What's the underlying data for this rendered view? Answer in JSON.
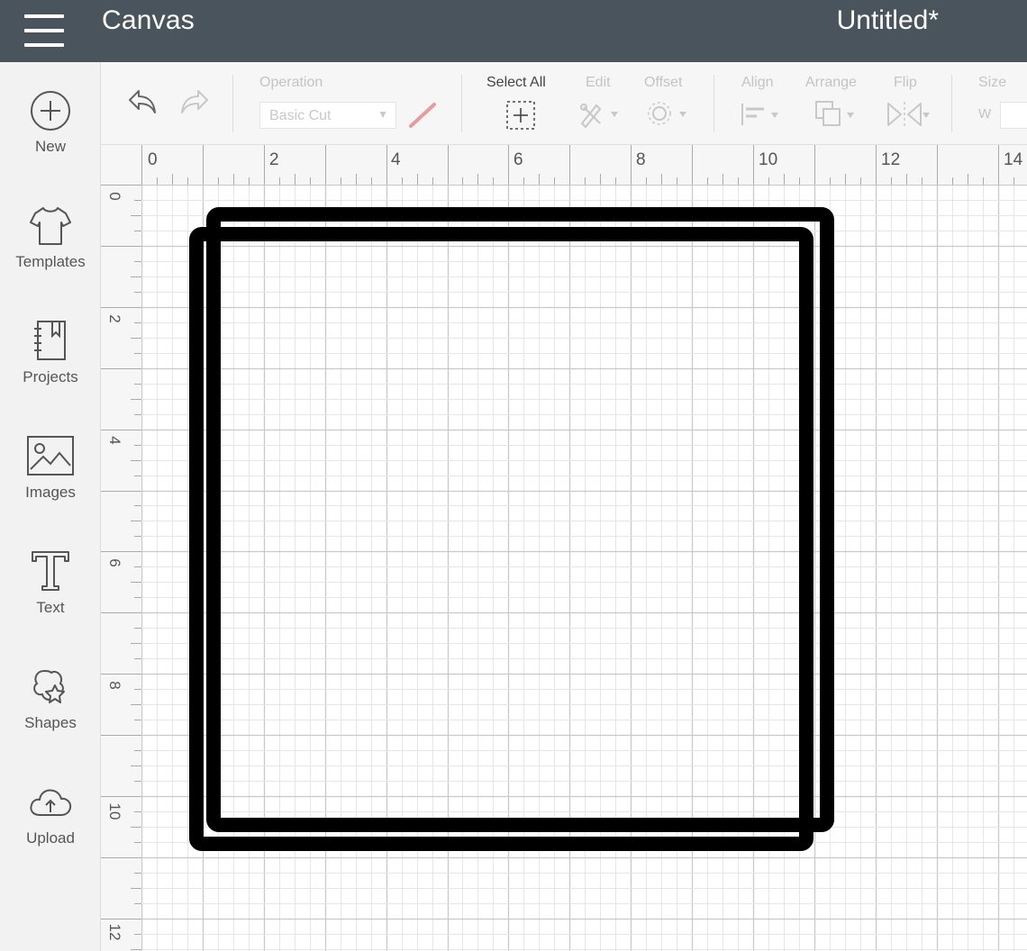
{
  "topbar": {
    "app_title": "Canvas",
    "doc_title": "Untitled*",
    "menu_icon": "hamburger-menu-icon"
  },
  "sidebar": {
    "items": [
      {
        "label": "New",
        "icon": "plus-circle-icon"
      },
      {
        "label": "Templates",
        "icon": "tshirt-icon"
      },
      {
        "label": "Projects",
        "icon": "notebook-icon"
      },
      {
        "label": "Images",
        "icon": "image-icon"
      },
      {
        "label": "Text",
        "icon": "text-t-icon"
      },
      {
        "label": "Shapes",
        "icon": "shapes-icon"
      },
      {
        "label": "Upload",
        "icon": "cloud-upload-icon"
      }
    ]
  },
  "toolbar": {
    "operation_label": "Operation",
    "operation_value": "Basic Cut",
    "select_all_label": "Select All",
    "edit_label": "Edit",
    "offset_label": "Offset",
    "align_label": "Align",
    "arrange_label": "Arrange",
    "flip_label": "Flip",
    "size_label": "Size",
    "size_w_label": "W"
  },
  "rulers": {
    "top_numbers": [
      "0",
      "2",
      "4",
      "6",
      "8",
      "10",
      "12",
      "14"
    ],
    "left_numbers": [
      "0",
      "2",
      "4",
      "6",
      "8",
      "10",
      "12"
    ]
  },
  "colors": {
    "topbar_bg": "#4a545c",
    "operation_line": "#e89aa0",
    "shape_stroke": "#000000"
  }
}
